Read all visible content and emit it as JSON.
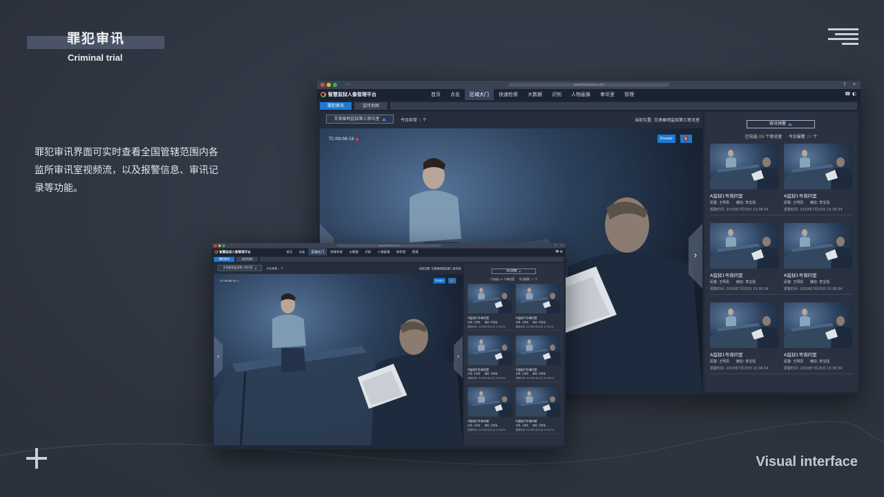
{
  "slide": {
    "title": "罪犯审讯",
    "subtitle": "Criminal trial",
    "description": "罪犯审讯界面可实时查看全国管辖范围内各监所审讯室视频流，以及报警信息、审讯记录等功能。",
    "footer": "Visual interface"
  },
  "browser": {
    "url": "www.zhihuijianyu.com"
  },
  "app": {
    "title": "智慧监狱人像管理平台",
    "nav": [
      "首页",
      "点名",
      "区域大门",
      "快速检索",
      "大数据",
      "识别",
      "人物画像",
      "审讯室",
      "管理"
    ],
    "active_nav_index": 2,
    "tabs": [
      "罪犯审讯",
      "监所地图"
    ],
    "active_tab_index": 0
  },
  "controls": {
    "room_select": "甘肃泰明监狱第三审讯室",
    "abnormal_prefix": "今日异常",
    "abnormal_count": "1",
    "abnormal_unit": "个",
    "location_label": "当前位置:",
    "location_value": "甘肃泰明监狱第三审讯室"
  },
  "video": {
    "timecode": "TC:09:08:19",
    "drawer_label": "Drawer",
    "mute_icon": "speaker-mute-icon"
  },
  "panel": {
    "alarm_button": "审讯预警",
    "selected_prefix": "已勾选",
    "selected_count": "09",
    "selected_unit": "个审讯室",
    "today_prefix": "今日报警",
    "today_count": "20",
    "today_unit": "个",
    "cards": [
      {
        "title": "A监狱1号询问室",
        "police_label": "民警:",
        "police": "王明贵",
        "criminal_label": "嫌犯:",
        "criminal": "李宝强",
        "time_label": "报警时间:",
        "time": "2019年7月25日 15:38:34"
      },
      {
        "title": "A监狱1号询问室",
        "police_label": "民警:",
        "police": "王明贵",
        "criminal_label": "嫌犯:",
        "criminal": "李宝强",
        "time_label": "报警时间:",
        "time": "2019年7月25日 15:38:34"
      },
      {
        "title": "A监狱1号询问室",
        "police_label": "民警:",
        "police": "王明贵",
        "criminal_label": "嫌犯:",
        "criminal": "李宝强",
        "time_label": "报警时间:",
        "time": "2019年7月25日 15:38:34"
      },
      {
        "title": "A监狱1号询问室",
        "police_label": "民警:",
        "police": "王明贵",
        "criminal_label": "嫌犯:",
        "criminal": "李宝强",
        "time_label": "报警时间:",
        "time": "2019年7月25日 15:38:34"
      },
      {
        "title": "A监狱1号询问室",
        "police_label": "民警:",
        "police": "王明贵",
        "criminal_label": "嫌犯:",
        "criminal": "李宝强",
        "time_label": "报警时间:",
        "time": "2019年7月25日 15:38:34"
      },
      {
        "title": "A监狱1号询问室",
        "police_label": "民警:",
        "police": "王明贵",
        "criminal_label": "嫌犯:",
        "criminal": "李宝强",
        "time_label": "报警时间:",
        "time": "2019年7月25日 15:38:34"
      }
    ]
  },
  "colors": {
    "accent": "#1f79d1",
    "alert": "#e2483d",
    "highlight": "#f0a33a"
  }
}
